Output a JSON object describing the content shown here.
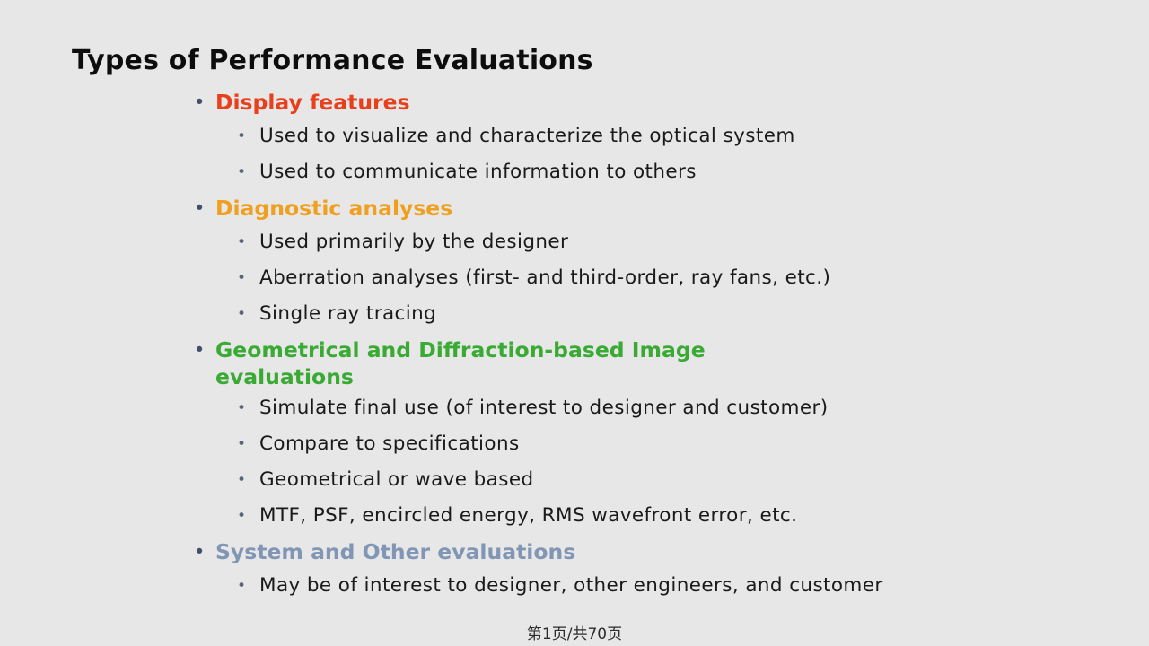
{
  "slide": {
    "title": "Types of Performance Evaluations",
    "background_color": "#e7e7e7",
    "title_color": "#0d0d0d",
    "bullet_glyph_level1": "•",
    "bullet_glyph_level2": "•",
    "bullet_color_level1": "#44506b",
    "bullet_color_level2": "#5b6478",
    "body_text_color": "#1a1a1a"
  },
  "colors": {
    "red": "#e8401c",
    "amber": "#f0a020",
    "green": "#3aaa35",
    "slate": "#8196b4"
  },
  "content": {
    "items": [
      {
        "level": 1,
        "text": "Display features",
        "color": "#e8401c"
      },
      {
        "level": 2,
        "text": "Used to visualize and characterize the optical system",
        "color": "#1a1a1a"
      },
      {
        "level": 2,
        "text": "Used to communicate information to others",
        "color": "#1a1a1a"
      },
      {
        "level": 1,
        "text": "Diagnostic analyses",
        "color": "#f0a020"
      },
      {
        "level": 2,
        "text": "Used primarily by the designer",
        "color": "#1a1a1a"
      },
      {
        "level": 2,
        "text": "Aberration analyses (first- and third-order, ray fans, etc.)",
        "color": "#1a1a1a"
      },
      {
        "level": 2,
        "text": "Single ray tracing",
        "color": "#1a1a1a"
      },
      {
        "level": 1,
        "text": "Geometrical and Diffraction-based Image evaluations",
        "color": "#3aaa35"
      },
      {
        "level": 2,
        "text": "Simulate final use (of interest to designer and customer)",
        "color": "#1a1a1a"
      },
      {
        "level": 2,
        "text": "Compare to specifications",
        "color": "#1a1a1a"
      },
      {
        "level": 2,
        "text": "Geometrical or wave based",
        "color": "#1a1a1a"
      },
      {
        "level": 2,
        "text": "MTF, PSF, encircled energy, RMS wavefront error, etc.",
        "color": "#1a1a1a"
      },
      {
        "level": 1,
        "text": "System and Other evaluations",
        "color": "#8196b4"
      },
      {
        "level": 2,
        "text": "May be of interest to designer, other engineers, and customer",
        "color": "#1a1a1a"
      }
    ]
  },
  "footer": {
    "page_indicator": "第1页/共7 0页",
    "page_indicator_text": "第1页/共70页"
  }
}
